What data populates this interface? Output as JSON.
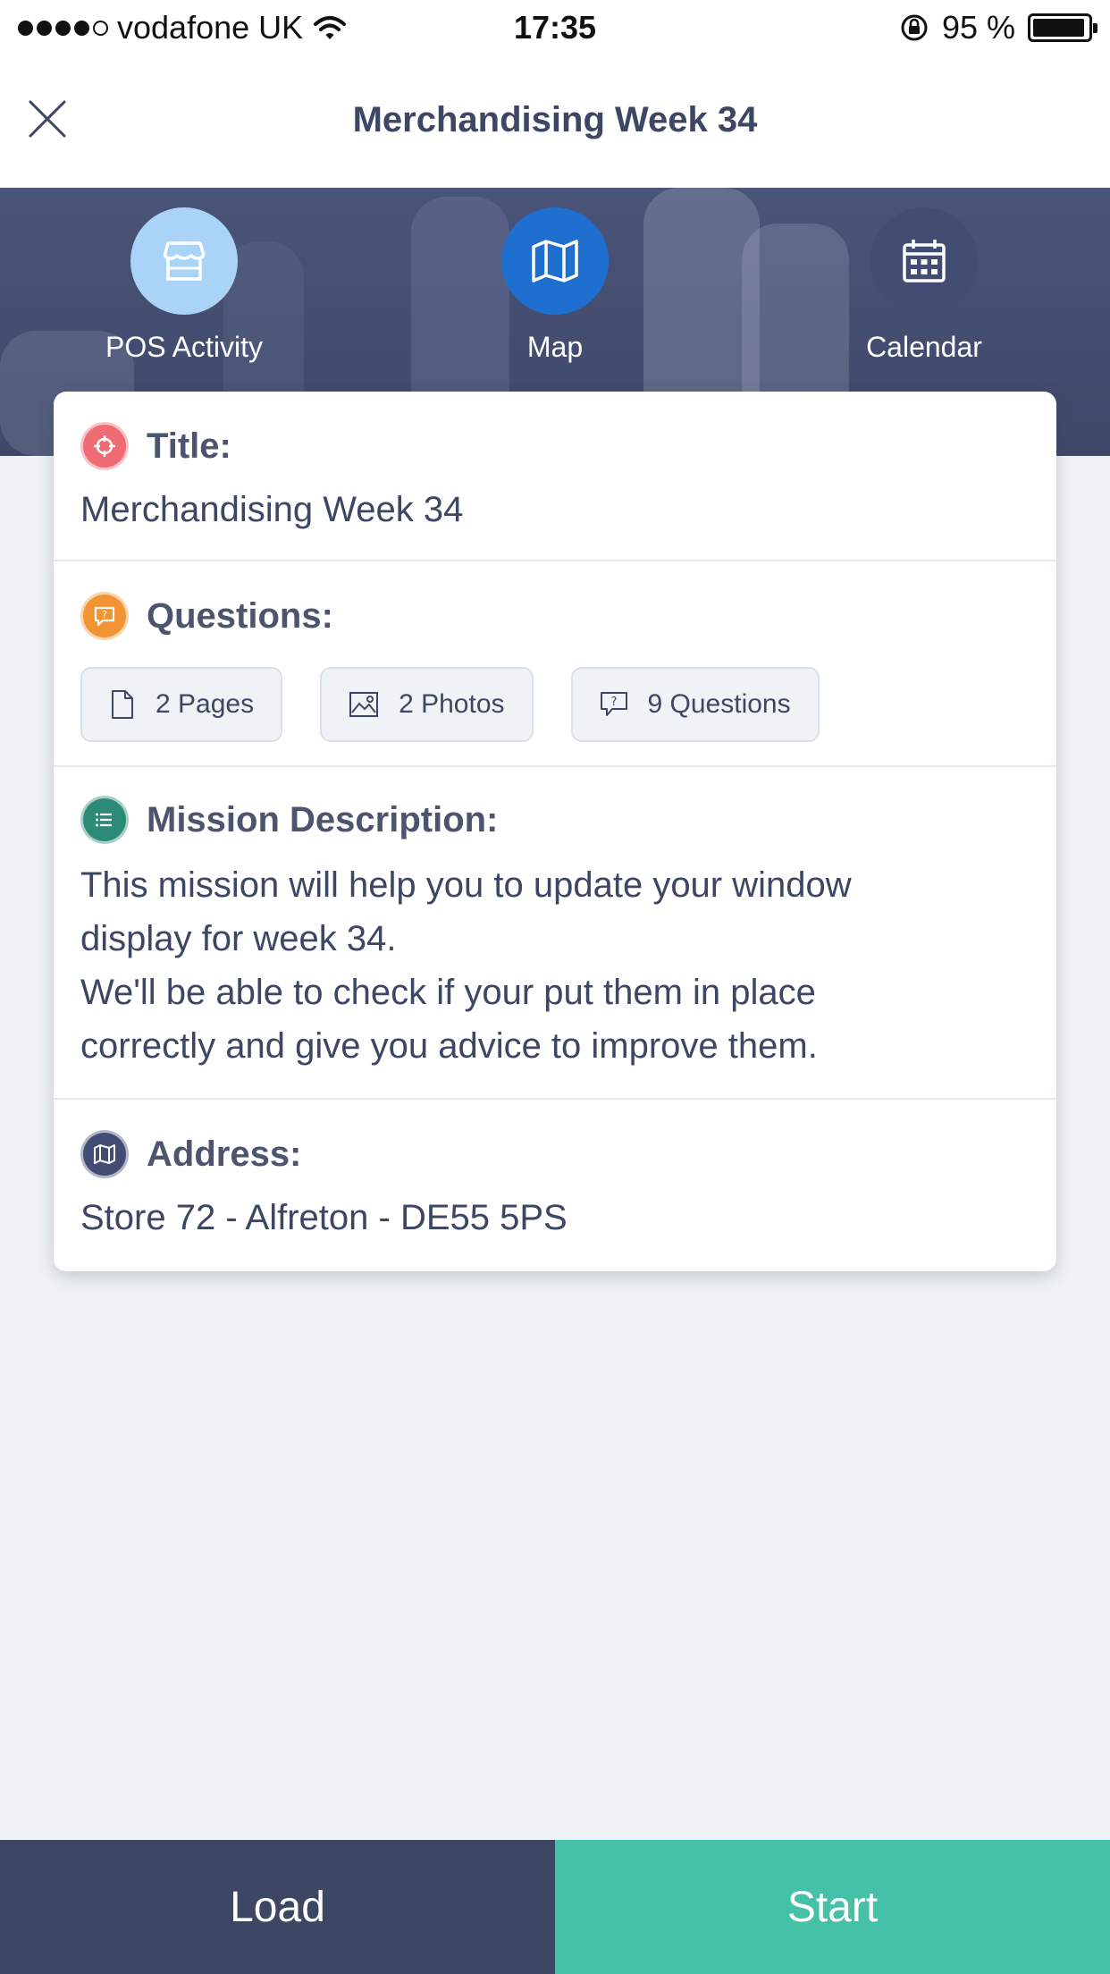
{
  "status_bar": {
    "carrier": "vodafone UK",
    "time": "17:35",
    "battery_text": "95 %",
    "battery_level": 0.95,
    "signal_bars_filled": 4,
    "signal_bars_total": 5
  },
  "header": {
    "title": "Merchandising Week 34",
    "close_icon": "close-icon"
  },
  "tabs": [
    {
      "label": "POS Activity",
      "icon": "store-icon",
      "color": "#a9d3f7"
    },
    {
      "label": "Map",
      "icon": "map-icon",
      "color": "#1f6fd0"
    },
    {
      "label": "Calendar",
      "icon": "calendar-icon",
      "color": "#434d73"
    }
  ],
  "card": {
    "title_section": {
      "label": "Title:",
      "value": "Merchandising Week 34",
      "icon": "target-icon",
      "icon_color": "#f06c74"
    },
    "questions_section": {
      "label": "Questions:",
      "icon": "question-bubble-icon",
      "icon_color": "#f39434",
      "chips": [
        {
          "label": "2 Pages",
          "icon": "page-icon"
        },
        {
          "label": "2 Photos",
          "icon": "photo-icon"
        },
        {
          "label": "9 Questions",
          "icon": "question-bubble-icon"
        }
      ]
    },
    "description_section": {
      "label": "Mission Description:",
      "icon": "list-icon",
      "icon_color": "#2e8a78",
      "line1": "This mission will help you to update your window",
      "line2": "display for week 34.",
      "line3": "We'll be able to check if your put them in place",
      "line4": "correctly and give you advice to improve them."
    },
    "address_section": {
      "label": "Address:",
      "value": "Store 72 - Alfreton - DE55 5PS",
      "icon": "map-icon",
      "icon_color": "#434d73"
    }
  },
  "bottom": {
    "load_label": "Load",
    "start_label": "Start"
  }
}
